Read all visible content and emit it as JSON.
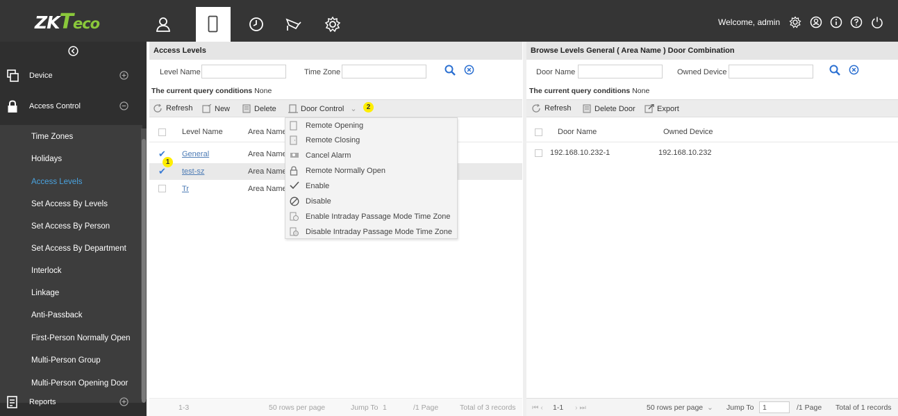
{
  "app": {
    "logo_main": "ZK",
    "logo_t": "T",
    "logo_eco": "eco",
    "welcome": "Welcome, admin"
  },
  "nav": {
    "icons": [
      "person-icon",
      "door-icon",
      "clock-icon",
      "camera-icon",
      "gear-icon"
    ],
    "active_index": 1,
    "top_icons": [
      "settings-icon",
      "account-icon",
      "info-icon",
      "help-icon",
      "power-icon"
    ]
  },
  "sidebar": {
    "categories": [
      {
        "label": "Device",
        "icon": "device-icon",
        "state": "+"
      },
      {
        "label": "Access Control",
        "icon": "lock-icon",
        "state": "-"
      },
      {
        "label": "Reports",
        "icon": "reports-icon",
        "state": "+"
      }
    ],
    "items": [
      {
        "label": "Time Zones"
      },
      {
        "label": "Holidays"
      },
      {
        "label": "Access Levels"
      },
      {
        "label": "Set Access By Levels"
      },
      {
        "label": "Set Access By Person"
      },
      {
        "label": "Set Access By Department"
      },
      {
        "label": "Interlock"
      },
      {
        "label": "Linkage"
      },
      {
        "label": "Anti-Passback"
      },
      {
        "label": "First-Person Normally Open"
      },
      {
        "label": "Multi-Person Group"
      },
      {
        "label": "Multi-Person Opening Door"
      }
    ],
    "active_item": "Access Levels"
  },
  "left": {
    "title": "Access Levels",
    "filter": {
      "level_name_label": "Level Name",
      "level_name_value": "",
      "time_zone_label": "Time Zone",
      "time_zone_value": ""
    },
    "query": {
      "prefix": "The current query conditions",
      "value": "None"
    },
    "toolbar": {
      "refresh": "Refresh",
      "new": "New",
      "delete": "Delete",
      "door_control": "Door Control"
    },
    "columns": [
      "Level Name",
      "Area Name"
    ],
    "rows": [
      {
        "level": "General",
        "area": "Area Name",
        "checked": true
      },
      {
        "level": "test-sz",
        "area": "Area Name",
        "checked": true
      },
      {
        "level": "Tr",
        "area": "Area Name",
        "checked": false
      }
    ],
    "markers": {
      "one": "1",
      "two": "2"
    },
    "footer": {
      "range": "1-3",
      "per_page": "50 rows per page",
      "jump_to": "Jump To",
      "page_value": "1",
      "page_total": "/1 Page",
      "total": "Total of 3 records"
    }
  },
  "dropdown": {
    "items": [
      {
        "label": "Remote Opening",
        "icon": "remote-opening-icon"
      },
      {
        "label": "Remote Closing",
        "icon": "remote-closing-icon"
      },
      {
        "label": "Cancel Alarm",
        "icon": "cancel-alarm-icon"
      },
      {
        "label": "Remote Normally Open",
        "icon": "normally-open-icon"
      },
      {
        "label": "Enable",
        "icon": "check-icon"
      },
      {
        "label": "Disable",
        "icon": "disable-icon"
      },
      {
        "label": "Enable Intraday Passage Mode Time Zone",
        "icon": "enable-passage-icon"
      },
      {
        "label": "Disable Intraday Passage Mode Time Zone",
        "icon": "disable-passage-icon"
      }
    ]
  },
  "right": {
    "title": "Browse Levels General ( Area Name ) Door Combination",
    "filter": {
      "door_name_label": "Door Name",
      "door_name_value": "",
      "owned_device_label": "Owned Device",
      "owned_device_value": ""
    },
    "query": {
      "prefix": "The current query conditions",
      "value": "None"
    },
    "toolbar": {
      "refresh": "Refresh",
      "delete_door": "Delete Door",
      "export": "Export"
    },
    "columns": [
      "Door Name",
      "Owned Device"
    ],
    "rows": [
      {
        "door": "192.168.10.232-1",
        "device": "192.168.10.232"
      }
    ],
    "footer": {
      "range": "1-1",
      "per_page": "50 rows per page",
      "jump_to": "Jump To",
      "page_value": "1",
      "page_total": "/1 Page",
      "total": "Total of 1 records"
    }
  },
  "colors": {
    "topbar": "#353535",
    "sidebar": "#2f2f2f",
    "accent": "#4aa3df",
    "brand_green": "#8ac83b",
    "search_blue": "#2a6fd1",
    "marker": "#ffee00"
  }
}
